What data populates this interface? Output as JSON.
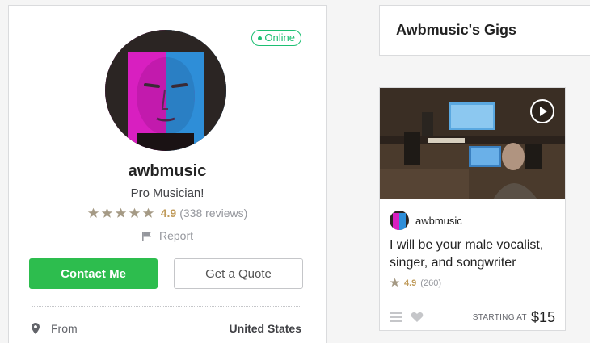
{
  "profile": {
    "status": "Online",
    "username": "awbmusic",
    "tagline": "Pro Musician!",
    "rating": "4.9",
    "reviews": "(338 reviews)",
    "report_label": "Report",
    "contact_label": "Contact Me",
    "quote_label": "Get a Quote",
    "from_label": "From",
    "from_value": "United States",
    "star_count": 5,
    "colors": {
      "online": "#1dbf73",
      "contact_button": "#2dbd4e",
      "star": "#b5a68c"
    }
  },
  "gigs": {
    "header": "Awbmusic's Gigs",
    "items": [
      {
        "seller": "awbmusic",
        "title": "I will be your male vocalist, singer, and songwriter",
        "rating": "4.9",
        "reviews": "(260)",
        "starting_label": "STARTING AT",
        "price": "$15"
      }
    ]
  }
}
